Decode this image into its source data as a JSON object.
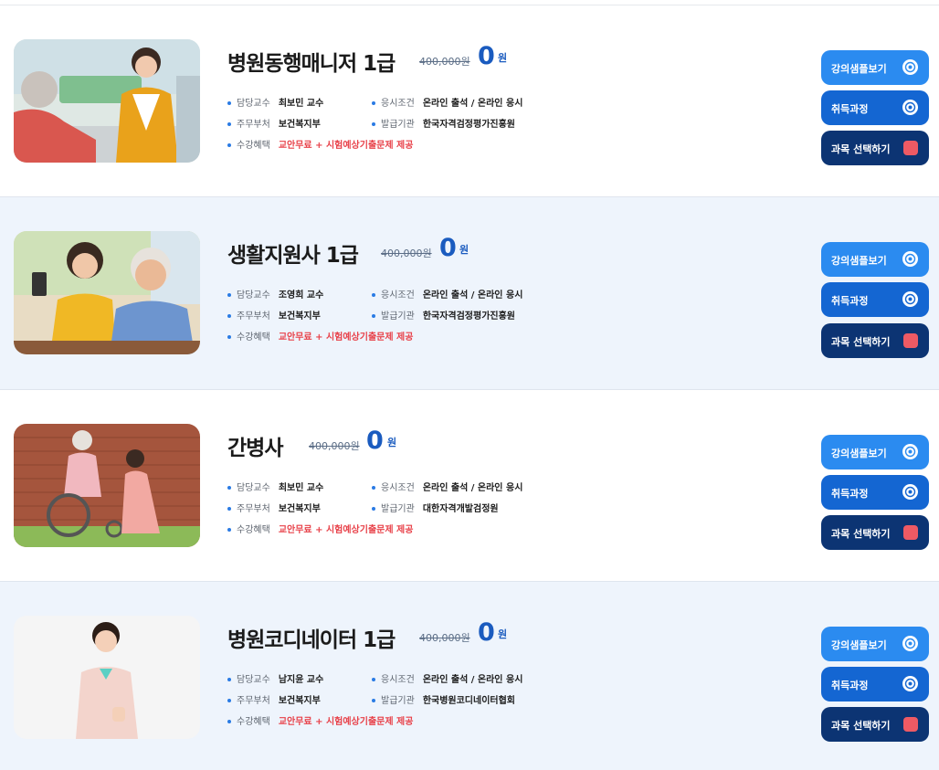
{
  "courses": [
    {
      "title": "병원동행매니저 1급",
      "original_price": "400,000원",
      "price": "0",
      "price_unit": "원",
      "professor_label": "담당교수",
      "professor": "최보민 교수",
      "exam_label": "응시조건",
      "exam": "온라인 출석 / 온라인 응시",
      "ministry_label": "주무부처",
      "ministry": "보건복지부",
      "issuer_label": "발급기관",
      "issuer": "한국자격검정평가진흥원",
      "benefit_label": "수강혜택",
      "benefit": "교안무료 + 시험예상기출문제 제공",
      "sample_btn": "강의샘플보기",
      "course_btn": "취득과정",
      "select_btn": "과목 선택하기"
    },
    {
      "title": "생활지원사 1급",
      "original_price": "400,000원",
      "price": "0",
      "price_unit": "원",
      "professor_label": "담당교수",
      "professor": "조영희 교수",
      "exam_label": "응시조건",
      "exam": "온라인 출석 / 온라인 응시",
      "ministry_label": "주무부처",
      "ministry": "보건복지부",
      "issuer_label": "발급기관",
      "issuer": "한국자격검정평가진흥원",
      "benefit_label": "수강혜택",
      "benefit": "교안무료 + 시험예상기출문제 제공",
      "sample_btn": "강의샘플보기",
      "course_btn": "취득과정",
      "select_btn": "과목 선택하기"
    },
    {
      "title": "간병사",
      "original_price": "400,000원",
      "price": "0",
      "price_unit": "원",
      "professor_label": "담당교수",
      "professor": "최보민 교수",
      "exam_label": "응시조건",
      "exam": "온라인 출석 / 온라인 응시",
      "ministry_label": "주무부처",
      "ministry": "보건복지부",
      "issuer_label": "발급기관",
      "issuer": "대한자격개발검정원",
      "benefit_label": "수강혜택",
      "benefit": "교안무료 + 시험예상기출문제 제공",
      "sample_btn": "강의샘플보기",
      "course_btn": "취득과정",
      "select_btn": "과목 선택하기"
    },
    {
      "title": "병원코디네이터 1급",
      "original_price": "400,000원",
      "price": "0",
      "price_unit": "원",
      "professor_label": "담당교수",
      "professor": "남지윤 교수",
      "exam_label": "응시조건",
      "exam": "온라인 출석 / 온라인 응시",
      "ministry_label": "주무부처",
      "ministry": "보건복지부",
      "issuer_label": "발급기관",
      "issuer": "한국병원코디네이터협회",
      "benefit_label": "수강혜택",
      "benefit": "교안무료 + 시험예상기출문제 제공",
      "sample_btn": "강의샘플보기",
      "course_btn": "취득과정",
      "select_btn": "과목 선택하기"
    }
  ],
  "colors": {
    "accent_blue": "#1a5bbf",
    "button_light": "#2b8bf0",
    "button_mid": "#1466d2",
    "button_dark": "#0c3473",
    "benefit_red": "#e8424a",
    "alt_row_bg": "#eef4fc"
  },
  "icons": {
    "sample": "eye-icon",
    "course": "eye-icon",
    "select": "square-icon"
  }
}
